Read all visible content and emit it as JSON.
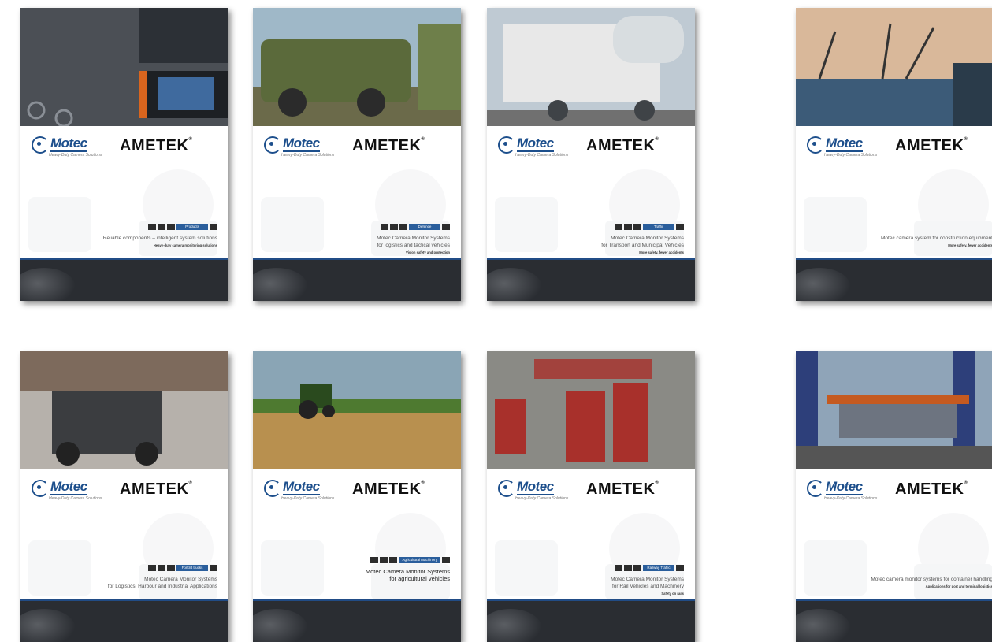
{
  "brand": {
    "motec": "Motec",
    "motec_tagline": "Heavy-Duty Camera Solutions",
    "ametek": "AMETEK"
  },
  "covers": [
    {
      "id": "products",
      "category": "Products",
      "title": "Reliable components – intelligent system solutions",
      "subtitle": "Heavy-duty camera monitoring solutions",
      "photo_icon": "camera-monitor-photo",
      "colors": [
        "#4b4f55",
        "#2c3036",
        "#8a8f96"
      ]
    },
    {
      "id": "defence",
      "category": "Defence",
      "title": "Motec Camera Monitor Systems\nfor logistics and tactical vehicles",
      "subtitle": "Vision safety and protection",
      "photo_icon": "armored-vehicle-photo",
      "colors": [
        "#9fb8c8",
        "#5b6a3b",
        "#6e7f4a"
      ]
    },
    {
      "id": "traffic",
      "category": "Traffic",
      "title": "Motec Camera Monitor Systems\nfor Transport and Municipal Vehicles",
      "subtitle": "More safety, fewer accidents",
      "photo_icon": "garbage-truck-photo",
      "colors": [
        "#bfcad3",
        "#e8e8e8",
        "#3f4347"
      ]
    },
    {
      "id": "construction",
      "category": "",
      "title": "Motec camera system for construction equipment",
      "subtitle": "More safety, fewer accidents",
      "photo_icon": "cranes-photo",
      "colors": [
        "#d9b89a",
        "#3c5b78",
        "#8aa0b3"
      ]
    },
    {
      "id": "forklift",
      "category": "Forklift trucks",
      "title": "Motec Camera Monitor Systems\nfor Logistics, Harbour and Industrial Applications",
      "subtitle": "",
      "photo_icon": "forklift-photo",
      "colors": [
        "#7d6a5c",
        "#3b3d40",
        "#b6b1ab"
      ]
    },
    {
      "id": "agri",
      "category": "Agricultural machinery",
      "title": "Motec Camera Monitor Systems\nfor agricultural vehicles",
      "subtitle": "",
      "photo_icon": "tractor-field-photo",
      "colors": [
        "#8aa5b5",
        "#b8904f",
        "#3f6b2a"
      ]
    },
    {
      "id": "rail",
      "category": "Railway Traffic",
      "title": "Motec Camera Monitor Systems\nfor Rail Vehicles and Machinery",
      "subtitle": "Safety on rails",
      "photo_icon": "trains-photo",
      "colors": [
        "#8a8a85",
        "#a8302b",
        "#5c5f5a"
      ]
    },
    {
      "id": "port",
      "category": "",
      "title": "Motec camera monitor systems for container handling",
      "subtitle": "Applications for port and terminal logistics",
      "photo_icon": "container-crane-photo",
      "colors": [
        "#8fa4b8",
        "#2d3f7a",
        "#c55a20"
      ]
    }
  ]
}
